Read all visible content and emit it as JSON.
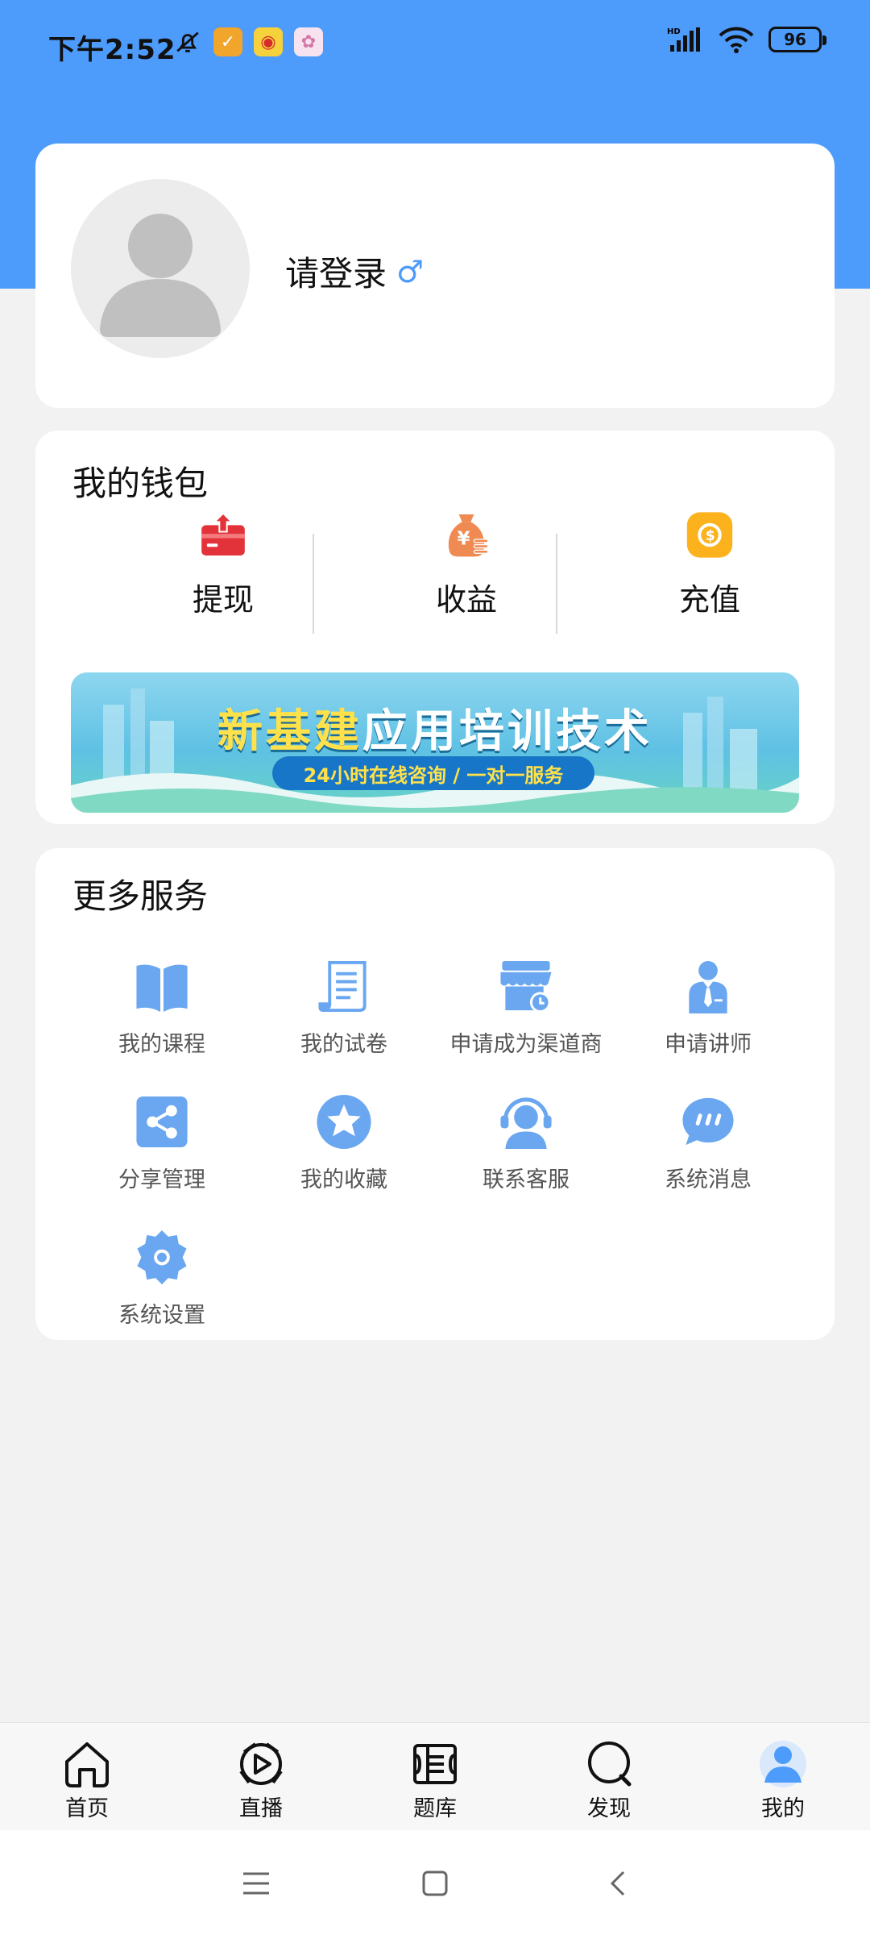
{
  "status_bar": {
    "time": "下午2:52",
    "battery": "96"
  },
  "profile": {
    "login_text": "请登录",
    "gender_symbol": "♂"
  },
  "wallet": {
    "title": "我的钱包",
    "items": [
      {
        "label": "提现",
        "icon": "withdraw-icon"
      },
      {
        "label": "收益",
        "icon": "money-bag-icon"
      },
      {
        "label": "充值",
        "icon": "coin-icon"
      }
    ],
    "banner": {
      "title_highlight": "新基建",
      "title_rest": "应用培训技术",
      "subtitle": "24小时在线咨询 / 一对一服务"
    }
  },
  "services": {
    "title": "更多服务",
    "items": [
      {
        "label": "我的课程",
        "icon": "book-icon"
      },
      {
        "label": "我的试卷",
        "icon": "exam-paper-icon"
      },
      {
        "label": "申请成为渠道商",
        "icon": "shop-icon"
      },
      {
        "label": "申请讲师",
        "icon": "teacher-icon"
      },
      {
        "label": "分享管理",
        "icon": "share-icon"
      },
      {
        "label": "我的收藏",
        "icon": "star-icon"
      },
      {
        "label": "联系客服",
        "icon": "customer-service-icon"
      },
      {
        "label": "系统消息",
        "icon": "message-icon"
      },
      {
        "label": "系统设置",
        "icon": "settings-icon"
      }
    ]
  },
  "tabbar": {
    "tabs": [
      {
        "label": "首页",
        "icon": "home-icon"
      },
      {
        "label": "直播",
        "icon": "live-icon"
      },
      {
        "label": "题库",
        "icon": "question-bank-icon"
      },
      {
        "label": "发现",
        "icon": "discover-icon"
      },
      {
        "label": "我的",
        "icon": "profile-icon",
        "active": true
      }
    ]
  },
  "colors": {
    "brand": "#4d9bfb",
    "icon_blue": "#6aa7f0"
  }
}
